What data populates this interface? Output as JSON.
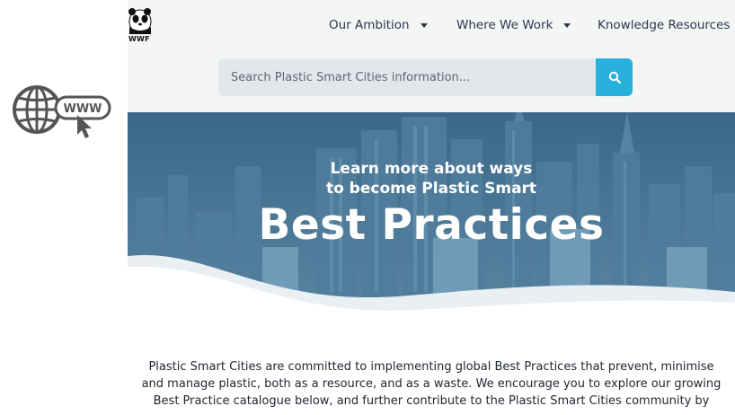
{
  "brand": {
    "logo_text": "WWF"
  },
  "nav": {
    "items": [
      {
        "label": "Our Ambition"
      },
      {
        "label": "Where We Work"
      },
      {
        "label": "Knowledge Resources"
      }
    ]
  },
  "search": {
    "placeholder": "Search Plastic Smart Cities information...",
    "button_icon": "search-icon"
  },
  "hero": {
    "subtitle_line1": "Learn more about ways",
    "subtitle_line2": "to become Plastic Smart",
    "title": "Best Practices"
  },
  "intro": {
    "line1": "Plastic Smart Cities are committed to implementing global Best Practices that prevent, minimise",
    "line2": "and manage plastic, both as a resource, and as a waste. We encourage you to explore our growing",
    "line3": "Best Practice catalogue below, and further contribute to the Plastic Smart Cities community by"
  },
  "side_icon": {
    "label": "WWW",
    "icon": "globe-www-cursor-icon"
  },
  "colors": {
    "accent": "#27b1db",
    "hero_bg": "#3e6c8c",
    "topbar_bg": "#f4f6f6"
  }
}
